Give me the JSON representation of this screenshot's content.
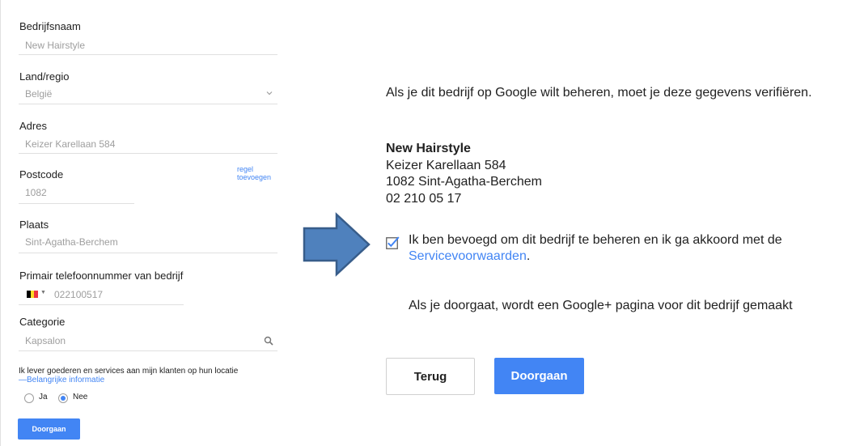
{
  "form": {
    "fields": [
      {
        "label": "Bedrijfsnaam",
        "value": "New Hairstyle"
      },
      {
        "label": "Land/regio",
        "value": "België"
      },
      {
        "label": "Adres",
        "value": "Keizer Karellaan 584"
      },
      {
        "label": "Postcode",
        "value": "1082"
      },
      {
        "label": "Plaats",
        "value": "Sint-Agatha-Berchem"
      },
      {
        "label": "Primair telefoonnummer van bedrijf",
        "value": "022100517"
      },
      {
        "label": "Categorie",
        "value": "Kapsalon"
      }
    ],
    "add_line_link": "regel toevoegen",
    "flag_icon": "belgium-flag-icon",
    "flag_colors": [
      "#000000",
      "#fdda24",
      "#ef3340"
    ],
    "deliver_question": "Ik lever goederen en services aan mijn klanten op hun locatie",
    "info_link": "—Belangrijke informatie",
    "radio_yes": "Ja",
    "radio_no": "Nee",
    "radio_selected": "Nee",
    "submit_label": "Doorgaan"
  },
  "arrow": {
    "icon": "right-arrow-icon",
    "fill": "#4f81bd",
    "stroke": "#385d8a"
  },
  "panel": {
    "intro": "Als je dit bedrijf op Google wilt beheren, moet je deze gegevens verifiëren.",
    "business_name": "New Hairstyle",
    "address_lines": [
      "Keizer Karellaan 584",
      "1082 Sint-Agatha-Berchem",
      "02 210 05 17"
    ],
    "agree_checked": true,
    "agree_text": "Ik ben bevoegd om dit bedrijf te beheren en ik ga akkoord met de ",
    "tos_link": "Servicevoorwaarden",
    "agree_end": ".",
    "note": "Als je doorgaat, wordt een Google+ pagina voor dit bedrijf gemaakt",
    "back_label": "Terug",
    "continue_label": "Doorgaan"
  },
  "colors": {
    "accent": "#4285f4",
    "muted": "#9e9e9e",
    "divider": "#e0e0e0"
  }
}
